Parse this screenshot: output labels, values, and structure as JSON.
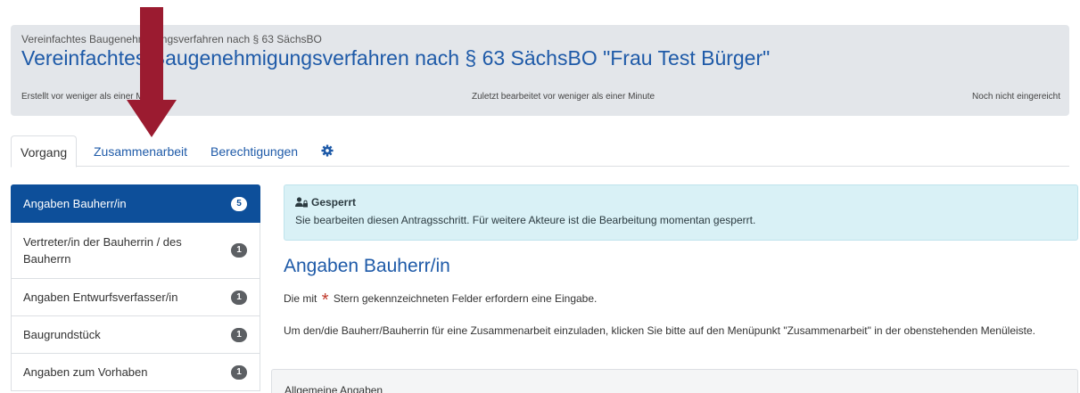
{
  "header": {
    "subtitle": "Vereinfachtes Baugenehmigungsverfahren nach § 63 SächsBO",
    "title": "Vereinfachtes Baugenehmigungsverfahren nach § 63 SächsBO \"Frau Test Bürger\"",
    "created": "Erstellt vor weniger als einer Minute",
    "edited": "Zuletzt bearbeitet vor weniger als einer Minute",
    "status": "Noch nicht eingereicht"
  },
  "tabs": [
    {
      "label": "Vorgang"
    },
    {
      "label": "Zusammenarbeit"
    },
    {
      "label": "Berechtigungen"
    }
  ],
  "icons": {
    "settings": "gear-icon",
    "lock": "lock-user-icon",
    "annotation": "arrow-down-icon"
  },
  "colors": {
    "accent": "#1e5aa8",
    "active_nav": "#0d4f9a",
    "arrow": "#9b1b30",
    "alert_bg": "#d9f1f6"
  },
  "sidebar": {
    "items": [
      {
        "label": "Angaben Bauherr/in",
        "count": "5"
      },
      {
        "label": "Vertreter/in der Bauherrin / des Bauherrn",
        "count": "1"
      },
      {
        "label": "Angaben Entwurfsverfasser/in",
        "count": "1"
      },
      {
        "label": "Baugrundstück",
        "count": "1"
      },
      {
        "label": "Angaben zum Vorhaben",
        "count": "1"
      }
    ]
  },
  "alert": {
    "title": "Gesperrt",
    "text": "Sie bearbeiten diesen Antragsschritt. Für weitere Akteure ist die Bearbeitung momentan gesperrt."
  },
  "main": {
    "heading": "Angaben Bauherr/in",
    "required_prefix": "Die mit",
    "required_star": "*",
    "required_suffix": "Stern gekennzeichneten Felder erfordern eine Eingabe.",
    "invite_text": "Um den/die Bauherr/Bauherrin für eine Zusammenarbeit einzuladen, klicken Sie bitte auf den Menüpunkt \"Zusammenarbeit\" in der obenstehenden Menüleiste.",
    "section_title": "Allgemeine Angaben"
  }
}
